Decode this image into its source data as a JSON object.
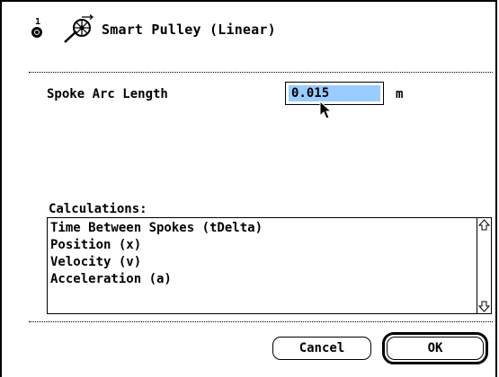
{
  "dialog": {
    "port_number": "1",
    "port_icon": "port-connector-icon",
    "sensor_icon": "smart-pulley-icon",
    "title": "Smart Pulley (Linear)"
  },
  "parameter": {
    "label": "Spoke Arc Length",
    "value": "0.015",
    "unit": "m",
    "selection_color": "#99ccff"
  },
  "calculations": {
    "label": "Calculations:",
    "items": [
      "Time Between Spokes (tDelta)",
      "Position (x)",
      "Velocity (v)",
      "Acceleration (a)"
    ]
  },
  "buttons": {
    "cancel": "Cancel",
    "ok": "OK"
  }
}
